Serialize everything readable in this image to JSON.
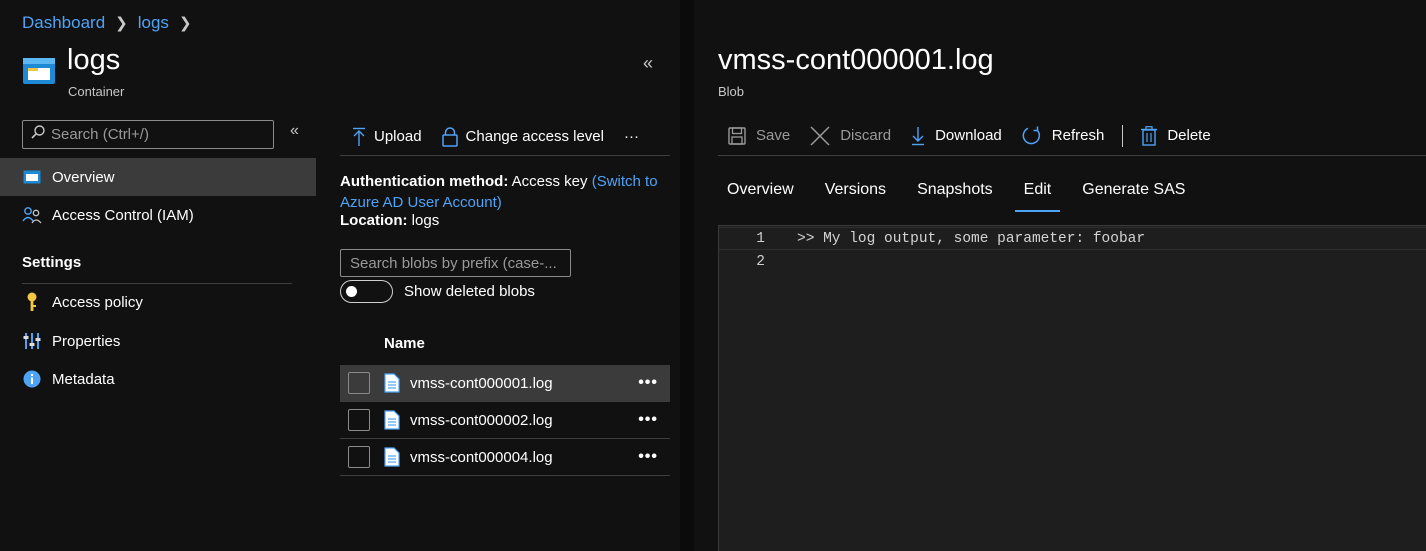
{
  "breadcrumb": {
    "items": [
      "Dashboard",
      "logs"
    ]
  },
  "resource": {
    "title": "logs",
    "subtitle": "Container",
    "collapse_icon": "«"
  },
  "left_menu": {
    "search_placeholder": "Search (Ctrl+/)",
    "collapse_icon": "«",
    "items": [
      {
        "label": "Overview",
        "icon": "container-icon",
        "active": true
      },
      {
        "label": "Access Control (IAM)",
        "icon": "people-icon",
        "active": false
      }
    ],
    "settings_heading": "Settings",
    "settings_items": [
      {
        "label": "Access policy",
        "icon": "key-icon"
      },
      {
        "label": "Properties",
        "icon": "sliders-icon"
      },
      {
        "label": "Metadata",
        "icon": "info-icon"
      }
    ]
  },
  "blob_toolbar": {
    "upload": "Upload",
    "change_access": "Change access level",
    "more": "···"
  },
  "auth": {
    "label": "Authentication method:",
    "value": "Access key",
    "switch_link": "(Switch to Azure AD User Account)",
    "location_label": "Location:",
    "location_value": "logs"
  },
  "blob_search": {
    "placeholder": "Search blobs by prefix (case-..."
  },
  "deleted_toggle": {
    "label": "Show deleted blobs",
    "on": false
  },
  "blob_list": {
    "name_header": "Name",
    "rows": [
      {
        "name": "vmss-cont000001.log",
        "selected": true
      },
      {
        "name": "vmss-cont000002.log",
        "selected": false
      },
      {
        "name": "vmss-cont000004.log",
        "selected": false
      }
    ],
    "more": "•••"
  },
  "blob": {
    "title": "vmss-cont000001.log",
    "subtitle": "Blob",
    "toolbar": {
      "save": "Save",
      "discard": "Discard",
      "download": "Download",
      "refresh": "Refresh",
      "delete": "Delete"
    },
    "tabs": [
      "Overview",
      "Versions",
      "Snapshots",
      "Edit",
      "Generate SAS"
    ],
    "active_tab": "Edit",
    "editor": {
      "lines": [
        {
          "number": "1",
          "text": ">> My log output, some parameter: foobar"
        },
        {
          "number": "2",
          "text": ""
        }
      ]
    }
  },
  "colors": {
    "accent": "#4fa3f7",
    "background": "#111111",
    "selected": "#3b3b3b"
  }
}
